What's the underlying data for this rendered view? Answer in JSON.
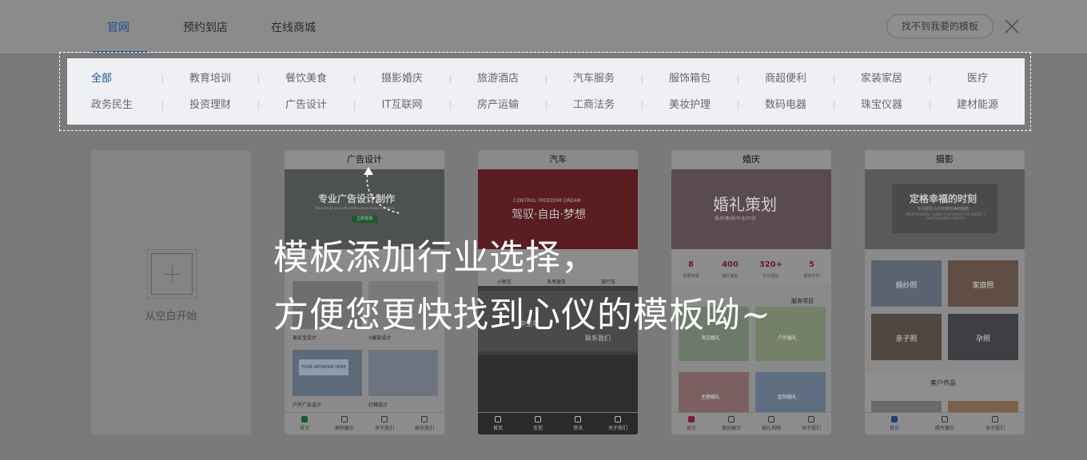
{
  "header": {
    "tabs": [
      {
        "label": "官网",
        "active": true
      },
      {
        "label": "预约到店",
        "active": false
      },
      {
        "label": "在线商城",
        "active": false
      }
    ],
    "not_found_button": "找不到我要的模板"
  },
  "categories": {
    "selected": "全部",
    "row1": [
      "全部",
      "教育培训",
      "餐饮美食",
      "摄影婚庆",
      "旅游酒店",
      "汽车服务",
      "服饰箱包",
      "商超便利",
      "家装家居",
      "医疗"
    ],
    "row2": [
      "政务民生",
      "投资理财",
      "广告设计",
      "IT互联网",
      "房产运输",
      "工商法务",
      "美妆护理",
      "数码电器",
      "珠宝仪器",
      "建材能源"
    ]
  },
  "blank_template": {
    "label": "从空白开始"
  },
  "templates": [
    {
      "title": "广告设计",
      "hero_title": "专业广告设计制作",
      "hero_sub": "We provide you with professional design solutions",
      "hero_button": "立即咨询",
      "captions": [
        "易拉宝设计",
        "X展架设计",
        "户外广告设计",
        "灯箱设计"
      ],
      "billboard_text": "YOUR ARTWORK HERE",
      "footer": [
        "首页",
        "案例展示",
        "关于我们",
        "联系我们"
      ]
    },
    {
      "title": "汽车",
      "hero_words": "CONTROL    FREEDOM    DREAM",
      "hero_title": "驾驭·自由·梦想",
      "captions": [
        "小轿车",
        "多用途车",
        "旅行车"
      ],
      "mid_labels": [
        "中型车",
        "联系我们"
      ],
      "footer": [
        "首页",
        "车型",
        "资讯",
        "关于我们"
      ]
    },
    {
      "title": "婚庆",
      "hero_title": "婚礼策划",
      "hero_sub": "婚/庆/策/划/专/业/打/造",
      "stats": [
        {
          "num": "8",
          "label": "就要幸福"
        },
        {
          "num": "400",
          "label": "婚礼策划"
        },
        {
          "num": "320+",
          "label": "礼仪团队"
        },
        {
          "num": "5",
          "label": "服务年份"
        }
      ],
      "section_title": "服务项目",
      "tiles": [
        "海边婚礼",
        "户外婚礼",
        "主题婚礼",
        "定制婚礼"
      ],
      "footer": [
        "首页",
        "案例展示",
        "婚礼视频",
        "关于我们"
      ]
    },
    {
      "title": "摄影",
      "hero_title": "定格幸福的时刻",
      "hero_sub": "专业团队为你定制完美的摄影",
      "hero_en": "PROFESSIONAL TEAMS CUSTOMIZE THE PERFECT PHOTOGRAPHY FOR YOU",
      "tiles": [
        "婚纱照",
        "家庭照",
        "亲子照",
        "孕照"
      ],
      "section_title": "客户作品",
      "footer": [
        "首页",
        "照片展示",
        "关于我们"
      ]
    }
  ],
  "overlay": {
    "line1": "模板添加行业选择，",
    "line2": "方便您更快找到心仪的模板呦~"
  }
}
